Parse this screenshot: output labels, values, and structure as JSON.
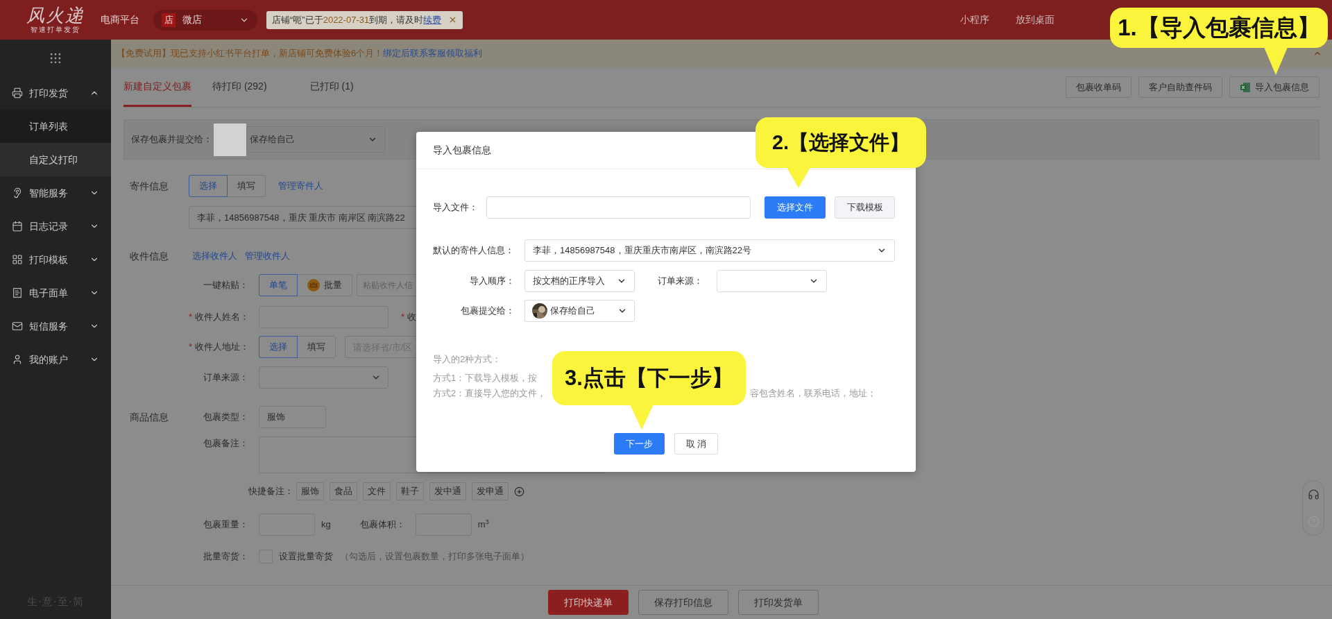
{
  "top_bar": {
    "logo": "风火递",
    "tagline": "智速打单发货",
    "platform_label": "电商平台",
    "shop_badge": "店",
    "shop_name": "微店",
    "expiry": {
      "before": "店铺“呃”已于",
      "date": "2022-07-31",
      "after": "到期，请及时",
      "link": "续费"
    },
    "links": [
      "小程序",
      "放到桌面"
    ]
  },
  "notice": {
    "text": "【免费试用】现已支持小红书平台打单，新店铺可免费体验6个月！",
    "link": "绑定后联系客服领取福利"
  },
  "sidebar": {
    "items": [
      {
        "label": "打印发货",
        "expanded": true,
        "children": [
          {
            "label": "订单列表",
            "selected": false
          },
          {
            "label": "自定义打印",
            "selected": true
          }
        ]
      },
      {
        "label": "智能服务",
        "expanded": false
      },
      {
        "label": "日志记录",
        "expanded": false
      },
      {
        "label": "打印模板",
        "expanded": false
      },
      {
        "label": "电子面单",
        "expanded": false
      },
      {
        "label": "短信服务",
        "expanded": false
      },
      {
        "label": "我的账户",
        "expanded": false
      }
    ],
    "footer": "生·意·至·简"
  },
  "tabs": [
    {
      "label": "新建自定义包裹",
      "selected": true
    },
    {
      "label": "待打印 (292)",
      "selected": false
    },
    {
      "label": "已打印 (1)",
      "selected": false
    }
  ],
  "toolbar": [
    {
      "label": "包裹收单码",
      "kind": "plain"
    },
    {
      "label": "客户自助查件码",
      "kind": "plain"
    },
    {
      "label": "导入包裹信息",
      "kind": "import"
    }
  ],
  "save_row": {
    "label": "保存包裹并提交给：",
    "value": "保存给自己"
  },
  "sender": {
    "label": "寄件信息",
    "modes": [
      {
        "label": "选择",
        "selected": true
      },
      {
        "label": "填写",
        "selected": false
      }
    ],
    "link": "管理寄件人",
    "address": "李菲，14856987548，重庆 重庆市 南岸区 南滨路22"
  },
  "recipient": {
    "label": "收件信息",
    "links": [
      "选择收件人",
      "管理收件人"
    ],
    "paste": {
      "label": "一键粘贴：",
      "modes": [
        {
          "label": "单笔",
          "selected": true
        },
        {
          "label": "批量",
          "selected": false
        }
      ],
      "placeholder": "粘贴收件人信"
    },
    "name": {
      "mark": "*",
      "label": "收件人姓名："
    },
    "second": {
      "mark": "*",
      "label": "收"
    },
    "address": {
      "mark": "*",
      "label": "收件人地址：",
      "modes": [
        {
          "label": "选择",
          "selected": true
        },
        {
          "label": "填写",
          "selected": false
        }
      ],
      "placeholder": "请选择省/市/区"
    },
    "source": {
      "label": "订单来源："
    }
  },
  "goods": {
    "label": "商品信息",
    "type": {
      "label": "包裹类型：",
      "value": "服饰"
    },
    "note": {
      "label": "包裹备注："
    },
    "quick": {
      "label": "快捷备注：",
      "tags": [
        "服饰",
        "食品",
        "文件",
        "鞋子",
        "发中通",
        "发申通"
      ]
    },
    "weight": {
      "label": "包裹重量：",
      "unit": "kg"
    },
    "volume": {
      "label": "包裹体积：",
      "unit": "m$^{3}$"
    },
    "batch": {
      "label": "批量寄货：",
      "checked": false,
      "option": "设置批量寄货",
      "hint": "（勾选后，设置包裹数量，打印多张电子面单）"
    }
  },
  "footer_buttons": [
    {
      "label": "打印快递单",
      "kind": "primary"
    },
    {
      "label": "保存打印信息",
      "kind": "default"
    },
    {
      "label": "打印发货单",
      "kind": "default"
    }
  ],
  "modal": {
    "title": "导入包裹信息",
    "file_label": "导入文件：",
    "choose_button": "选择文件",
    "template_button": "下载模板",
    "sender_label": "默认的寄件人信息：",
    "sender_value": "李菲，14856987548，重庆重庆市南岸区，南滨路22号",
    "order_label": "导入顺序：",
    "order_value": "按文档的正序导入",
    "source_label": "订单来源：",
    "submit_label": "包裹提交给：",
    "submit_value": "保存给自己",
    "methods_title": "导入的2种方式：",
    "method_1": "方式1：下载导入模板，按",
    "method_2": "方式2：直接导入您的文件，",
    "method_2_tail": "容包含姓名，联系电话，地址；",
    "next_button": "下一步",
    "cancel_button": "取 消"
  },
  "callouts": [
    {
      "text": "1.【导入包裹信息】"
    },
    {
      "text": "2.【选择文件】"
    },
    {
      "text": "3.点击【下一步】"
    }
  ]
}
